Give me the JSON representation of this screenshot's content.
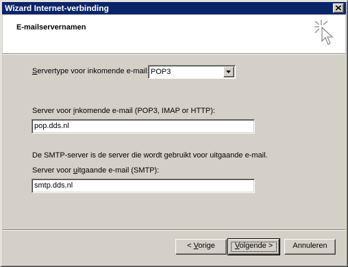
{
  "window": {
    "title": "Wizard Internet-verbinding",
    "close_icon": "close-icon"
  },
  "header": {
    "title": "E-mailservernamen",
    "icon": "wizard-sparkle-cursor-icon"
  },
  "form": {
    "servertype_label_pre": "",
    "servertype_label_key": "S",
    "servertype_label_post": "ervertype voor inkomende e-mail:",
    "servertype_value": "POP3",
    "incoming_label_pre": "Server voor ",
    "incoming_label_key": "i",
    "incoming_label_post": "nkomende e-mail (POP3, IMAP or HTTP):",
    "incoming_value": "pop.dds.nl",
    "smtp_info": "De SMTP-server is de server die wordt gebruikt voor uitgaande e-mail.",
    "outgoing_label_pre": "Server voor ",
    "outgoing_label_key": "u",
    "outgoing_label_post": "itgaande e-mail (SMTP):",
    "outgoing_value": "smtp.dds.nl"
  },
  "buttons": {
    "back_pre": "< ",
    "back_key": "V",
    "back_post": "orige",
    "next_pre": "",
    "next_key": "V",
    "next_post": "olgende >",
    "cancel": "Annuleren"
  },
  "colors": {
    "title_bar": "#0a246a",
    "face": "#d4d0c8",
    "header_bg": "#ffffff"
  }
}
